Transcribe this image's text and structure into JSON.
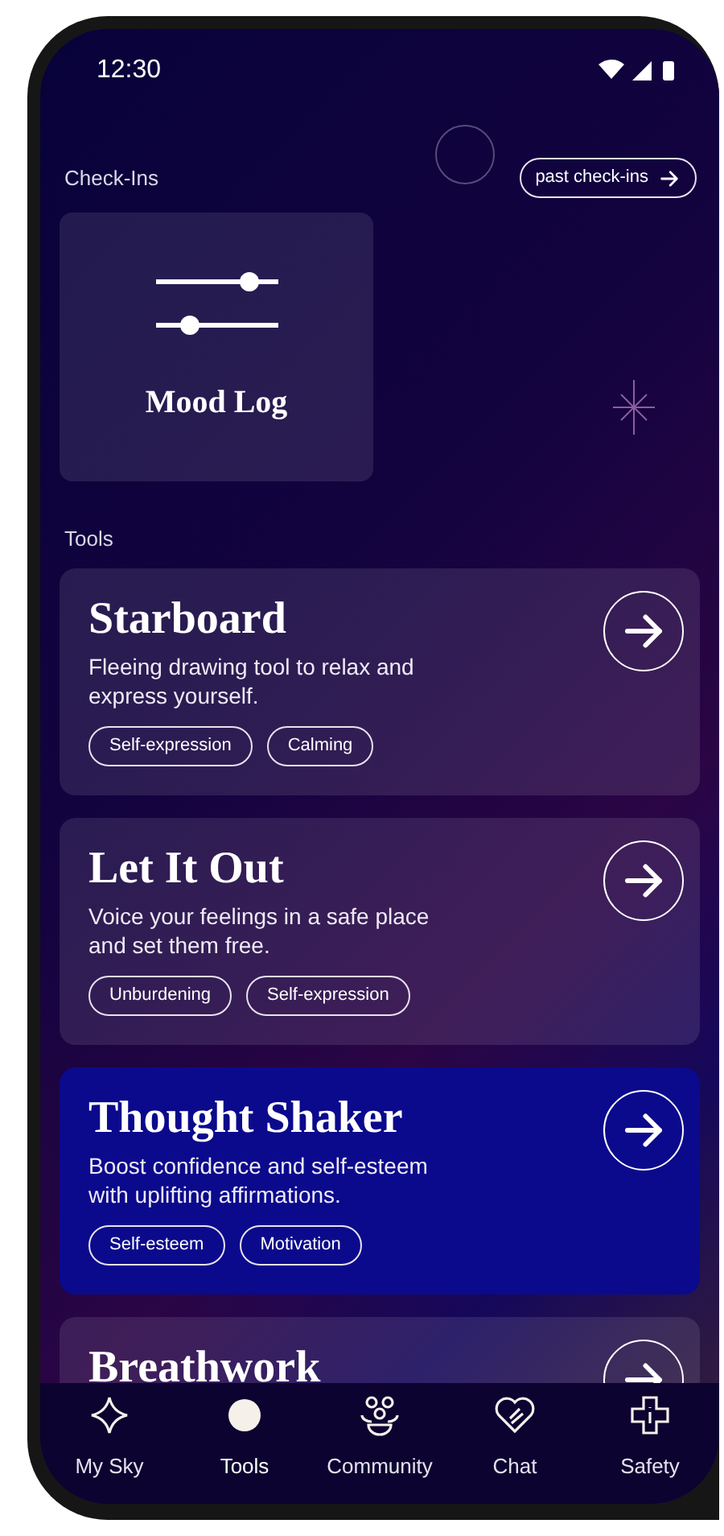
{
  "status_bar": {
    "time": "12:30"
  },
  "check_ins": {
    "heading": "Check-Ins",
    "link": "past check-ins",
    "card": {
      "title": "Mood Log"
    }
  },
  "tools": {
    "heading": "Tools",
    "cards": [
      {
        "title": "Starboard",
        "description": "Fleeing drawing tool to relax and express yourself.",
        "tags": [
          "Self-expression",
          "Calming"
        ],
        "highlighted": false
      },
      {
        "title": "Let It Out",
        "description": "Voice your feelings in a safe place and set them free.",
        "tags": [
          "Unburdening",
          "Self-expression"
        ],
        "highlighted": false
      },
      {
        "title": "Thought Shaker",
        "description": "Boost confidence and self-esteem with uplifting affirmations.",
        "tags": [
          "Self-esteem",
          "Motivation"
        ],
        "highlighted": true
      },
      {
        "title": "Breathwork",
        "highlighted": false
      }
    ]
  },
  "nav": [
    {
      "label": "My Sky",
      "selected": false
    },
    {
      "label": "Tools",
      "selected": true
    },
    {
      "label": "Community",
      "selected": false
    },
    {
      "label": "Chat",
      "selected": false
    },
    {
      "label": "Safety",
      "selected": false
    }
  ]
}
